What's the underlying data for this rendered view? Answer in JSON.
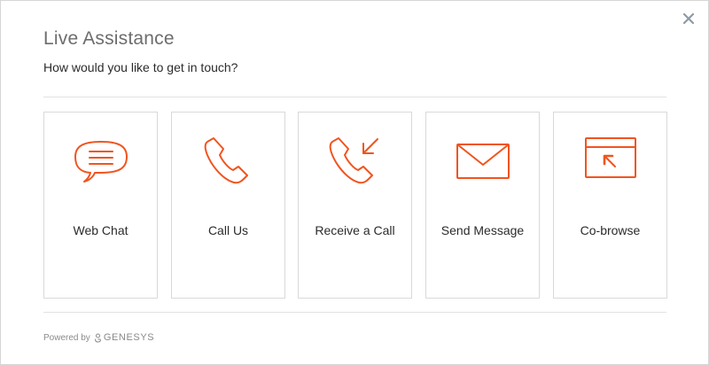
{
  "dialog": {
    "title": "Live Assistance",
    "subtitle": "How would you like to get in touch?",
    "close_icon": "close-icon"
  },
  "options": [
    {
      "label": "Web Chat",
      "icon": "chat-bubble-icon"
    },
    {
      "label": "Call Us",
      "icon": "phone-icon"
    },
    {
      "label": "Receive a Call",
      "icon": "incoming-call-icon"
    },
    {
      "label": "Send Message",
      "icon": "envelope-icon"
    },
    {
      "label": "Co-browse",
      "icon": "cobrowse-icon"
    }
  ],
  "footer": {
    "powered_by": "Powered by",
    "brand": "GENESYS",
    "brand_icon": "genesys-logo-icon"
  },
  "colors": {
    "accent": "#f1541f",
    "title_text": "#6d6d6d",
    "body_text": "#2b2b2b",
    "border": "#d9d9d9"
  }
}
